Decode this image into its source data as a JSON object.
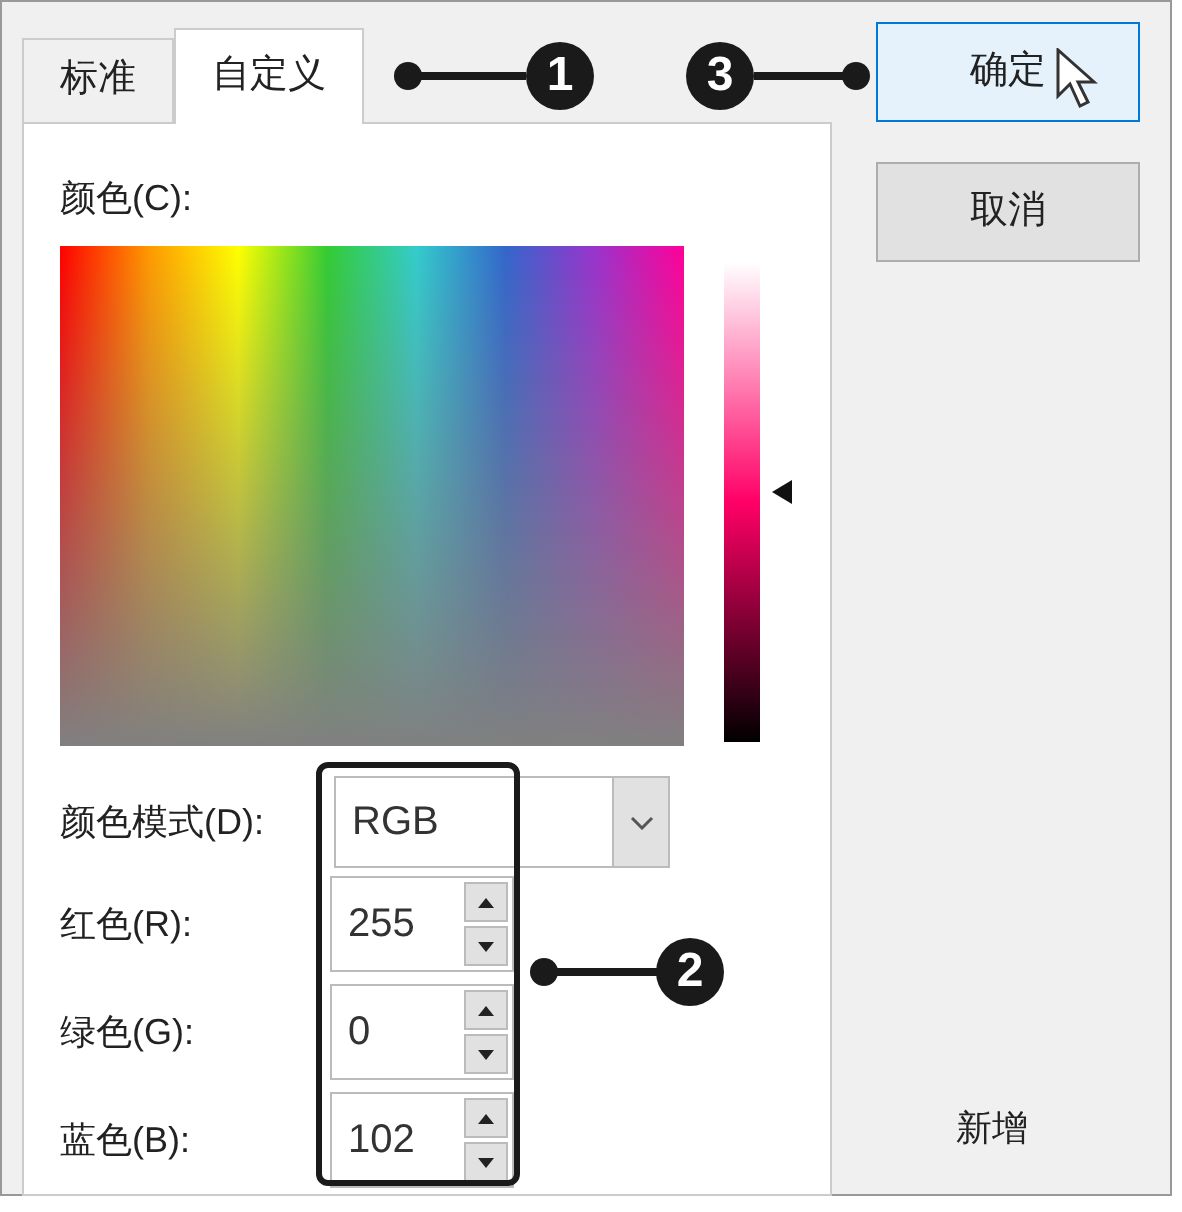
{
  "tabs": [
    {
      "label": "标准",
      "selected": false
    },
    {
      "label": "自定义",
      "selected": true
    }
  ],
  "color_label": "颜色(C):",
  "luminance": {
    "level": 0.52
  },
  "color_model": {
    "label": "颜色模式(D):",
    "value": "RGB"
  },
  "channels": [
    {
      "label": "红色(R):",
      "value": "255"
    },
    {
      "label": "绿色(G):",
      "value": "0"
    },
    {
      "label": "蓝色(B):",
      "value": "102"
    }
  ],
  "buttons": [
    {
      "label": "确定",
      "selected": true
    },
    {
      "label": "取消",
      "selected": false
    }
  ],
  "preview_label": "新增",
  "callouts": [
    "1",
    "2",
    "3"
  ]
}
